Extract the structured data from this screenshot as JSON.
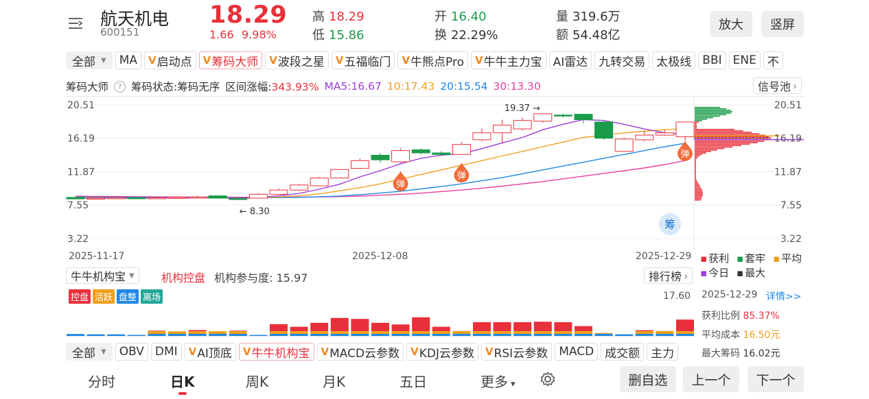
{
  "header": {
    "name": "航天机电",
    "code": "600151",
    "price": "18.29",
    "change": "1.66",
    "change_pct": "9.98%",
    "high_label": "高",
    "high": "18.29",
    "low_label": "低",
    "low": "15.86",
    "open_label": "开",
    "open": "16.40",
    "turnover_label": "换",
    "turnover": "22.29%",
    "volume_label": "量",
    "volume": "319.6万",
    "amount_label": "额",
    "amount": "54.48亿",
    "zoom_button": "放大",
    "portrait_button": "竖屏"
  },
  "indicator_tabs": [
    {
      "label": "全部",
      "v": false,
      "dropdown": true
    },
    {
      "label": "MA",
      "v": false
    },
    {
      "label": "启动点",
      "v": true
    },
    {
      "label": "筹码大师",
      "v": true,
      "active": true
    },
    {
      "label": "波段之星",
      "v": true
    },
    {
      "label": "五福临门",
      "v": true
    },
    {
      "label": "牛熊点Pro",
      "v": true
    },
    {
      "label": "牛牛主力宝",
      "v": true
    },
    {
      "label": "AI雷达",
      "v": false
    },
    {
      "label": "九转交易",
      "v": false
    },
    {
      "label": "太极线",
      "v": false
    },
    {
      "label": "BBI",
      "v": false
    },
    {
      "label": "ENE",
      "v": false
    },
    {
      "label": "不",
      "v": false
    }
  ],
  "info_line": {
    "title": "筹码大师",
    "status": "筹码状态:筹码无序",
    "range_label": "区间涨幅:",
    "range_value": "343.93%",
    "ma5": "MA5:16.67",
    "ma10": "10:17.43",
    "ma20": "20:15.54",
    "ma30": "30:13.30",
    "signal_pool": "信号池"
  },
  "colors": {
    "up": "#e8303a",
    "down": "#1a9b4a",
    "ma5": "#9b3ddb",
    "ma10": "#f0a020",
    "ma20": "#1e88e5",
    "ma30": "#e8409a",
    "chip_profit": "#e8303a",
    "chip_loss": "#1a9b4a"
  },
  "chart_data": [
    {
      "type": "candlestick",
      "title": "筹码大师",
      "y_ticks": [
        "20.51",
        "16.19",
        "11.87",
        "7.55",
        "3.22"
      ],
      "ylim": [
        3.22,
        20.51
      ],
      "x_labels": [
        "2025-11-17",
        "2025-12-08",
        "2025-12-29"
      ],
      "annotations": [
        {
          "text": "19.37",
          "arrow": "→"
        },
        {
          "text": "8.30",
          "arrow": "←"
        },
        {
          "text": "弹"
        },
        {
          "text": "弹"
        },
        {
          "text": "弹"
        },
        {
          "text": "筹"
        }
      ],
      "candles": [
        {
          "o": 8.55,
          "c": 8.35,
          "h": 8.6,
          "l": 8.3
        },
        {
          "o": 8.4,
          "c": 8.45,
          "h": 8.55,
          "l": 8.35
        },
        {
          "o": 8.45,
          "c": 8.5,
          "h": 8.6,
          "l": 8.4
        },
        {
          "o": 8.5,
          "c": 8.45,
          "h": 8.6,
          "l": 8.4
        },
        {
          "o": 8.45,
          "c": 8.5,
          "h": 8.65,
          "l": 8.4
        },
        {
          "o": 8.5,
          "c": 8.55,
          "h": 8.7,
          "l": 8.45
        },
        {
          "o": 8.55,
          "c": 8.6,
          "h": 8.75,
          "l": 8.5
        },
        {
          "o": 8.75,
          "c": 8.45,
          "h": 8.8,
          "l": 8.4
        },
        {
          "o": 8.4,
          "c": 8.3,
          "h": 8.45,
          "l": 8.3
        },
        {
          "o": 8.45,
          "c": 8.95,
          "h": 9.1,
          "l": 8.4
        },
        {
          "o": 8.95,
          "c": 9.5,
          "h": 9.7,
          "l": 8.9
        },
        {
          "o": 9.5,
          "c": 10.15,
          "h": 10.3,
          "l": 9.4
        },
        {
          "o": 10.05,
          "c": 11.05,
          "h": 11.2,
          "l": 10.0
        },
        {
          "o": 11.05,
          "c": 12.15,
          "h": 12.2,
          "l": 11.0
        },
        {
          "o": 12.3,
          "c": 13.3,
          "h": 13.6,
          "l": 12.2
        },
        {
          "o": 14.0,
          "c": 13.4,
          "h": 14.3,
          "l": 13.0
        },
        {
          "o": 13.15,
          "c": 14.6,
          "h": 14.9,
          "l": 13.0
        },
        {
          "o": 14.7,
          "c": 14.3,
          "h": 14.9,
          "l": 14.1
        },
        {
          "o": 14.3,
          "c": 14.1,
          "h": 14.5,
          "l": 13.9
        },
        {
          "o": 14.1,
          "c": 15.4,
          "h": 15.7,
          "l": 14.0
        },
        {
          "o": 16.0,
          "c": 16.9,
          "h": 17.5,
          "l": 15.8
        },
        {
          "o": 16.9,
          "c": 17.9,
          "h": 18.6,
          "l": 15.6
        },
        {
          "o": 17.4,
          "c": 18.5,
          "h": 18.9,
          "l": 17.2
        },
        {
          "o": 18.4,
          "c": 19.37,
          "h": 19.37,
          "l": 18.2
        },
        {
          "o": 19.2,
          "c": 19.1,
          "h": 19.4,
          "l": 18.9
        },
        {
          "o": 19.3,
          "c": 18.6,
          "h": 19.3,
          "l": 18.1
        },
        {
          "o": 18.3,
          "c": 16.2,
          "h": 18.4,
          "l": 16.0
        },
        {
          "o": 14.5,
          "c": 16.1,
          "h": 16.3,
          "l": 14.4
        },
        {
          "o": 16.0,
          "c": 16.6,
          "h": 17.2,
          "l": 15.8
        },
        {
          "o": 16.6,
          "c": 16.9,
          "h": 17.3,
          "l": 16.5
        },
        {
          "o": 16.4,
          "c": 18.29,
          "h": 18.29,
          "l": 15.86
        }
      ],
      "ma5": [
        8.5,
        8.45,
        8.45,
        8.46,
        8.46,
        8.48,
        8.5,
        8.52,
        8.46,
        8.55,
        8.74,
        9.05,
        9.6,
        10.25,
        11.2,
        12.0,
        12.9,
        13.6,
        14.0,
        14.2,
        14.85,
        15.6,
        16.3,
        17.3,
        18.0,
        18.6,
        18.5,
        18.0,
        17.4,
        16.9,
        16.67
      ],
      "ma10": [
        8.55,
        8.5,
        8.48,
        8.48,
        8.48,
        8.48,
        8.49,
        8.5,
        8.49,
        8.5,
        8.6,
        8.75,
        9.0,
        9.4,
        9.8,
        10.3,
        10.9,
        11.5,
        12.1,
        12.7,
        13.3,
        13.9,
        14.5,
        15.1,
        15.7,
        16.3,
        16.6,
        16.9,
        17.1,
        17.3,
        17.43
      ],
      "ma20": [
        8.6,
        8.58,
        8.55,
        8.54,
        8.52,
        8.51,
        8.5,
        8.5,
        8.5,
        8.5,
        8.52,
        8.56,
        8.62,
        8.72,
        8.9,
        9.1,
        9.35,
        9.65,
        9.95,
        10.3,
        10.7,
        11.1,
        11.6,
        12.1,
        12.6,
        13.1,
        13.6,
        14.1,
        14.6,
        15.1,
        15.54
      ],
      "ma30": [
        8.7,
        8.68,
        8.66,
        8.64,
        8.62,
        8.6,
        8.59,
        8.58,
        8.57,
        8.56,
        8.56,
        8.58,
        8.6,
        8.65,
        8.72,
        8.82,
        8.95,
        9.1,
        9.3,
        9.5,
        9.75,
        10.0,
        10.3,
        10.6,
        10.95,
        11.3,
        11.65,
        12.0,
        12.35,
        12.8,
        13.3
      ]
    },
    {
      "type": "bar",
      "title": "牛牛机构宝",
      "value_label": "机构参与度:",
      "value": "15.97",
      "max_label": "17.60",
      "legend": [
        {
          "name": "控盘",
          "color": "#e8303a"
        },
        {
          "name": "活跃",
          "color": "#f0a020"
        },
        {
          "name": "盘整",
          "color": "#1e88e5"
        },
        {
          "name": "离场",
          "color": "#26a69a"
        }
      ],
      "values": [
        1.2,
        1.0,
        1.0,
        0.6,
        3.2,
        2.8,
        3.6,
        2.9,
        3.2,
        0.6,
        7.2,
        5.6,
        8.0,
        11.0,
        10.4,
        8.0,
        7.0,
        11.4,
        5.6,
        3.0,
        8.4,
        8.4,
        8.4,
        8.7,
        8.4,
        6.0,
        1.8,
        1.0,
        3.5,
        3.0,
        10.0
      ]
    },
    {
      "type": "legend",
      "title": "筹码分布",
      "items": [
        {
          "name": "获利",
          "color": "#e8303a"
        },
        {
          "name": "套牢",
          "color": "#1a9b4a"
        },
        {
          "name": "平均",
          "color": "#f0a020"
        },
        {
          "name": "今日",
          "color": "#9b3ddb"
        },
        {
          "name": "最大",
          "color": "#333333"
        }
      ]
    }
  ],
  "chip_panel": {
    "date": "2025-12-29",
    "detail_link": "详情>>",
    "profit_label": "获利比例",
    "profit_value": "85.37%",
    "avg_cost_label": "平均成本",
    "avg_cost_value": "16.50元",
    "max_chip_label": "最大筹码",
    "max_chip_value": "16.02元"
  },
  "sub_indicator": {
    "selector": "牛牛机构宝",
    "title": "机构控盘",
    "rank_button": "排行榜"
  },
  "bottom_tabs": [
    {
      "label": "全部",
      "dropdown": true
    },
    {
      "label": "OBV",
      "v": false
    },
    {
      "label": "DMI",
      "v": false
    },
    {
      "label": "AI顶底",
      "v": true
    },
    {
      "label": "牛牛机构宝",
      "v": true,
      "active": true
    },
    {
      "label": "MACD云参数",
      "v": true
    },
    {
      "label": "KDJ云参数",
      "v": true
    },
    {
      "label": "RSI云参数",
      "v": true
    },
    {
      "label": "MACD",
      "v": false
    },
    {
      "label": "成交额",
      "v": false
    },
    {
      "label": "主力",
      "v": false
    }
  ],
  "nav": {
    "items": [
      "分时",
      "日K",
      "周K",
      "月K",
      "五日",
      "更多"
    ],
    "active": "日K",
    "delete_button": "删自选",
    "prev_button": "上一个",
    "next_button": "下一个"
  }
}
